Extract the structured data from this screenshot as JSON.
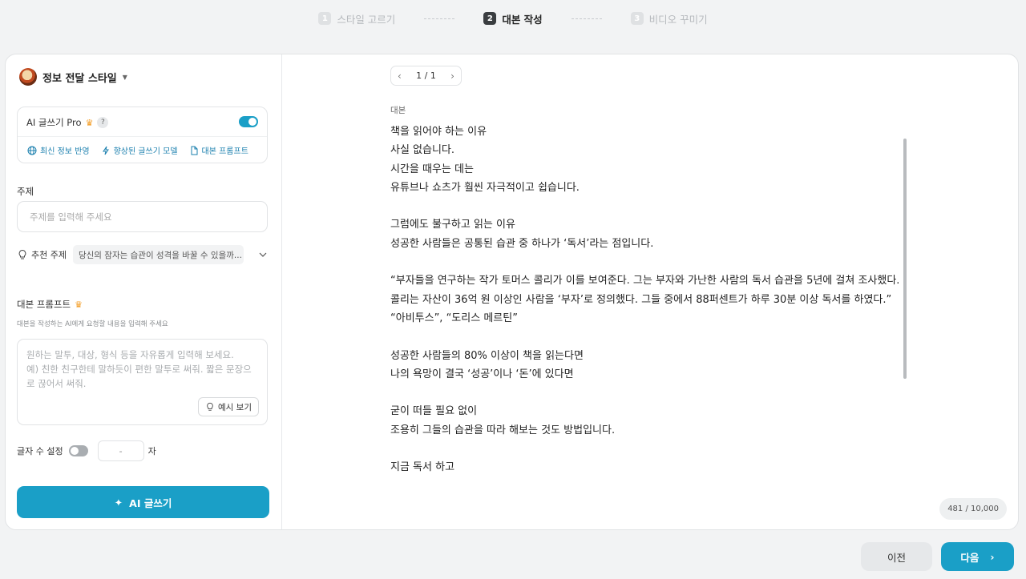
{
  "stepper": {
    "steps": [
      {
        "num": "1",
        "label": "스타일 고르기"
      },
      {
        "num": "2",
        "label": "대본 작성"
      },
      {
        "num": "3",
        "label": "비디오 꾸미기"
      }
    ],
    "active_index": 1
  },
  "left": {
    "style_name": "정보 전달 스타일",
    "pro": {
      "label": "AI 글쓰기 Pro",
      "help": "?",
      "enabled": true,
      "features": [
        "최신 정보 반영",
        "향상된 글쓰기 모델",
        "대본 프롬프트"
      ]
    },
    "subject": {
      "label": "주제",
      "placeholder": "주제를 입력해 주세요",
      "value": ""
    },
    "recommend": {
      "label": "추천 주제",
      "value": "당신의 잠자는 습관이 성격을 바꿀 수 있을까..."
    },
    "prompt": {
      "title": "대본 프롬프트",
      "hint": "대본을 작성하는 AI에게 요청할 내용을 입력해 주세요",
      "placeholder": "원하는 말투, 대상, 형식 등을 자유롭게 입력해 보세요.\n예) 친한 친구한테 말하듯이 편한 말투로 써줘. 짧은 문장으로 끊어서 써줘.",
      "example_button": "예시 보기"
    },
    "char_limit": {
      "label": "글자 수 설정",
      "enabled": false,
      "value": "-",
      "unit": "자"
    },
    "ai_button": "AI 글쓰기"
  },
  "right": {
    "pager": "1 / 1",
    "script_label": "대본",
    "script_lines": [
      "책을 읽어야 하는 이유",
      "사실 없습니다.",
      "시간을 때우는 데는",
      "유튜브나 쇼츠가 훨씬 자극적이고 쉽습니다.",
      "",
      "그럼에도 불구하고 읽는 이유",
      "성공한 사람들은 공통된 습관 중 하나가 ‘독서’라는 점입니다.",
      "",
      "“부자들을 연구하는 작가 토머스 콜리가 이를 보여준다. 그는 부자와 가난한 사람의 독서 습관을 5년에 걸쳐 조사했다. 콜리는 자산이 36억 원 이상인 사람을 ‘부자’로 정의했다. 그들 중에서 88퍼센트가 하루 30분 이상 독서를 하였다.”",
      "“아비투스”, “도리스 메르틴”",
      "",
      "성공한 사람들의 80% 이상이 책을 읽는다면",
      "나의 욕망이 결국 ‘성공’이나 ‘돈’에 있다면",
      "",
      "굳이 떠들 필요 없이",
      "조용히 그들의 습관을 따라 해보는 것도 방법입니다.",
      "",
      "지금 독서 하고"
    ],
    "char_count": "481 / 10,000"
  },
  "footer": {
    "prev": "이전",
    "next": "다음"
  },
  "colors": {
    "accent": "#1a9fc7",
    "crown": "#f39a1e"
  }
}
